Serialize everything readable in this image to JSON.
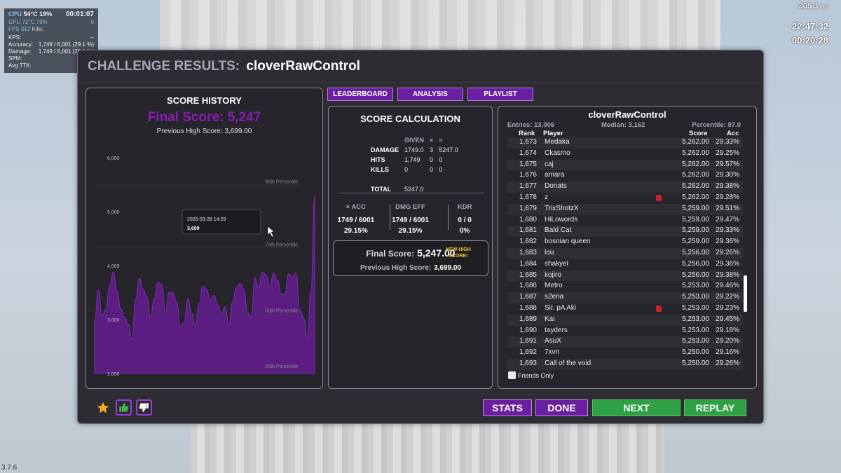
{
  "hud": {
    "cpu_label": "CPU",
    "cpu_value": "54°C 19%",
    "session_time": "00:01:07",
    "gpu_label": "GPU",
    "gpu_value": "72°C 79%",
    "fps_label": "FPS",
    "fps_value": "312",
    "kills_label": "Kills:",
    "kills_value": "0",
    "kps_label": "KPS:",
    "kps_value": "--",
    "accuracy_label": "Accuracy:",
    "accuracy_value": "1,749 / 6,001  (29.1 %)",
    "damage_label": "Damage:",
    "damage_value": "1,749 / 6,001  (29.1 %)",
    "spm_label": "SPM:",
    "spm_value": "",
    "ttk_label": "Avg TTK:",
    "ttk_value": ""
  },
  "overlay": {
    "fps": "305.3",
    "fps_unit": "FPS",
    "clock": "22:47:32",
    "timer": "00:20:28",
    "version": "3.7.6"
  },
  "header": {
    "label": "CHALLENGE RESULTS:",
    "scenario": "cloverRawControl"
  },
  "history": {
    "title": "SCORE HISTORY",
    "final_score": "Final Score: 5,247",
    "previous_high": "Previous High Score: 3,699.00",
    "tooltip_date": "2025-03-28 14:29",
    "tooltip_value": "3,699"
  },
  "chart_data": {
    "type": "area",
    "title": "SCORE HISTORY",
    "xlabel": "",
    "ylabel": "",
    "ylim": [
      2000,
      6000
    ],
    "y_ticks": [
      "6,000",
      "5,000",
      "4,000",
      "3,000",
      "2,000"
    ],
    "y_tick_values": [
      6000,
      5000,
      4000,
      3000,
      2000
    ],
    "percentile_lines": [
      {
        "label": "90th Percentile",
        "value": 5500
      },
      {
        "label": "75th Percentile",
        "value": 4330
      },
      {
        "label": "50th Percentile",
        "value": 3110
      },
      {
        "label": "25th Percentile",
        "value": 2080
      }
    ],
    "values": [
      2980,
      3560,
      3060,
      3190,
      3620,
      3880,
      3530,
      3200,
      3050,
      2920,
      2630,
      3380,
      3770,
      3560,
      3420,
      3040,
      3390,
      3690,
      3650,
      3120,
      3510,
      3500,
      3330,
      2860,
      2950,
      3390,
      3120,
      2880,
      3300,
      3620,
      3560,
      3360,
      3450,
      3270,
      3100,
      3240,
      2900,
      3330,
      3590,
      3670,
      3570,
      3130,
      3050,
      3770,
      3590,
      3880,
      3820,
      3600,
      3870,
      3730,
      3480,
      3460,
      3850,
      3790,
      3860,
      3190,
      3040,
      2670,
      3540,
      5300
    ],
    "grid": false
  },
  "tabs": {
    "leaderboard": "LEADERBOARD",
    "analysis": "ANALYSIS",
    "playlist": "PLAYLIST"
  },
  "calc": {
    "title": "SCORE CALCULATION",
    "given_label": "GIVEN",
    "times": "×",
    "equals": "=",
    "rows": [
      {
        "label": "DAMAGE",
        "given": "1749.0",
        "mult": "3",
        "result": "5247.0"
      },
      {
        "label": "HITS",
        "given": "1,749",
        "mult": "0",
        "result": "0"
      },
      {
        "label": "KILLS",
        "given": "0",
        "mult": "0",
        "result": "0"
      }
    ],
    "total_label": "TOTAL",
    "total_value": "5247.0",
    "metrics": [
      {
        "label": "× ACC",
        "value": "1749 / 6001",
        "pct": "29.15%"
      },
      {
        "label": "DMG EFF",
        "value": "1749 / 6001",
        "pct": "29.15%"
      },
      {
        "label": "KDR",
        "value": "0 / 0",
        "pct": "0%"
      }
    ],
    "final_label": "Final Score:",
    "final_value": "5,247.00",
    "new_high_1": "NEW HIGH",
    "new_high_2": "SCORE!",
    "prev_label": "Previous High Score:",
    "prev_value": "3,699.00"
  },
  "leaderboard": {
    "title": "cloverRawControl",
    "entries": "Entries: 13,006",
    "median": "Median: 3,162",
    "percentile": "Percentile: 87.0",
    "headers": {
      "rank": "Rank",
      "player": "Player",
      "score": "Score",
      "acc": "Acc"
    },
    "rows": [
      {
        "rank": "1,673",
        "player": "Medaka",
        "score": "5,262.00",
        "acc": "29.33%",
        "badge": false
      },
      {
        "rank": "1,674",
        "player": "Ckasmo",
        "score": "5,262.00",
        "acc": "29.25%",
        "badge": false
      },
      {
        "rank": "1,675",
        "player": "caj",
        "score": "5,262.00",
        "acc": "29.57%",
        "badge": false
      },
      {
        "rank": "1,676",
        "player": "amara",
        "score": "5,262.00",
        "acc": "29.30%",
        "badge": false
      },
      {
        "rank": "1,677",
        "player": "Donats",
        "score": "5,262.00",
        "acc": "29.38%",
        "badge": false
      },
      {
        "rank": "1,678",
        "player": "z",
        "score": "5,262.00",
        "acc": "29.28%",
        "badge": true
      },
      {
        "rank": "1,679",
        "player": "TrixShotzX",
        "score": "5,259.00",
        "acc": "29.51%",
        "badge": false
      },
      {
        "rank": "1,680",
        "player": "HiLowords",
        "score": "5,259.00",
        "acc": "29.47%",
        "badge": false
      },
      {
        "rank": "1,681",
        "player": "Bald Cat",
        "score": "5,259.00",
        "acc": "29.33%",
        "badge": false
      },
      {
        "rank": "1,682",
        "player": "bosnian queen",
        "score": "5,259.00",
        "acc": "29.36%",
        "badge": false
      },
      {
        "rank": "1,683",
        "player": "lou",
        "score": "5,256.00",
        "acc": "29.26%",
        "badge": false
      },
      {
        "rank": "1,684",
        "player": "shakyei",
        "score": "5,256.00",
        "acc": "29.36%",
        "badge": false
      },
      {
        "rank": "1,685",
        "player": "kojiro",
        "score": "5,256.00",
        "acc": "29.38%",
        "badge": false
      },
      {
        "rank": "1,686",
        "player": "Metro",
        "score": "5,253.00",
        "acc": "29.46%",
        "badge": false
      },
      {
        "rank": "1,687",
        "player": "s2ena",
        "score": "5,253.00",
        "acc": "29.22%",
        "badge": false
      },
      {
        "rank": "1,688",
        "player": "Sir. pA Aki",
        "score": "5,253.00",
        "acc": "29.23%",
        "badge": true
      },
      {
        "rank": "1,689",
        "player": "Kai",
        "score": "5,253.00",
        "acc": "29.45%",
        "badge": false
      },
      {
        "rank": "1,690",
        "player": "tayders",
        "score": "5,253.00",
        "acc": "29.18%",
        "badge": false
      },
      {
        "rank": "1,691",
        "player": "AsuX",
        "score": "5,253.00",
        "acc": "29.20%",
        "badge": false
      },
      {
        "rank": "1,692",
        "player": "7xvn",
        "score": "5,250.00",
        "acc": "29.16%",
        "badge": false
      },
      {
        "rank": "1,693",
        "player": "Call of the void",
        "score": "5,250.00",
        "acc": "29.26%",
        "badge": false
      }
    ],
    "friends_only": "Friends Only"
  },
  "bottom": {
    "stats": "STATS",
    "done": "DONE",
    "next": "NEXT",
    "replay": "REPLAY"
  },
  "colors": {
    "accent_purple": "#6a1fa0",
    "final_score_purple": "#8a1ab8",
    "next_green": "#2fa043",
    "new_high_yellow": "#f4c73a"
  }
}
